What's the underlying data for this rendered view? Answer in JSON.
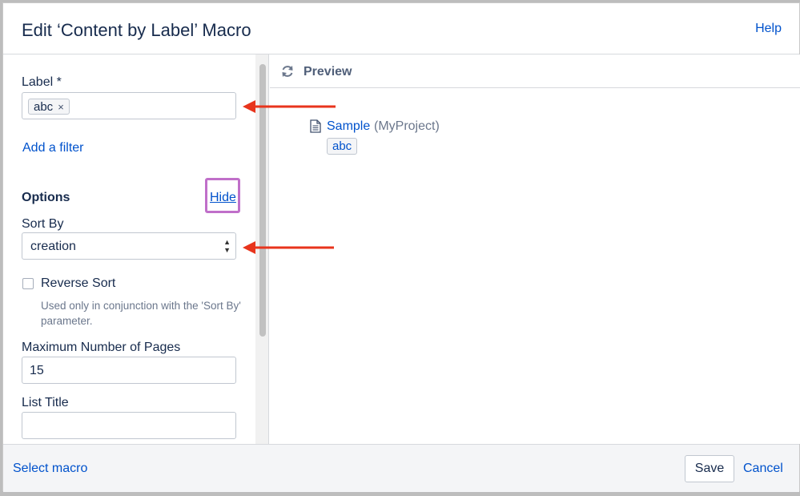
{
  "header": {
    "title": "Edit ‘Content by Label’ Macro",
    "help_label": "Help"
  },
  "form": {
    "label_field": {
      "label": "Label *",
      "chips": [
        "abc"
      ],
      "chip_remove": "×"
    },
    "add_filter_label": "Add a filter",
    "options_heading": "Options",
    "hide_label": "Hide",
    "sort_by": {
      "label": "Sort By",
      "selected": "creation"
    },
    "reverse_sort": {
      "label": "Reverse Sort",
      "checked": false,
      "hint": "Used only in conjunction with the 'Sort By' parameter."
    },
    "max_pages": {
      "label": "Maximum Number of Pages",
      "value": "15"
    },
    "list_title": {
      "label": "List Title",
      "value": ""
    }
  },
  "preview": {
    "title": "Preview",
    "results": [
      {
        "title": "Sample",
        "space": "(MyProject)",
        "tag": "abc"
      }
    ]
  },
  "footer": {
    "select_macro_label": "Select macro",
    "save_label": "Save",
    "cancel_label": "Cancel"
  },
  "colors": {
    "link": "#0052cc",
    "annotation_arrow": "#e8341c",
    "highlight_box": "#c06fc9"
  }
}
